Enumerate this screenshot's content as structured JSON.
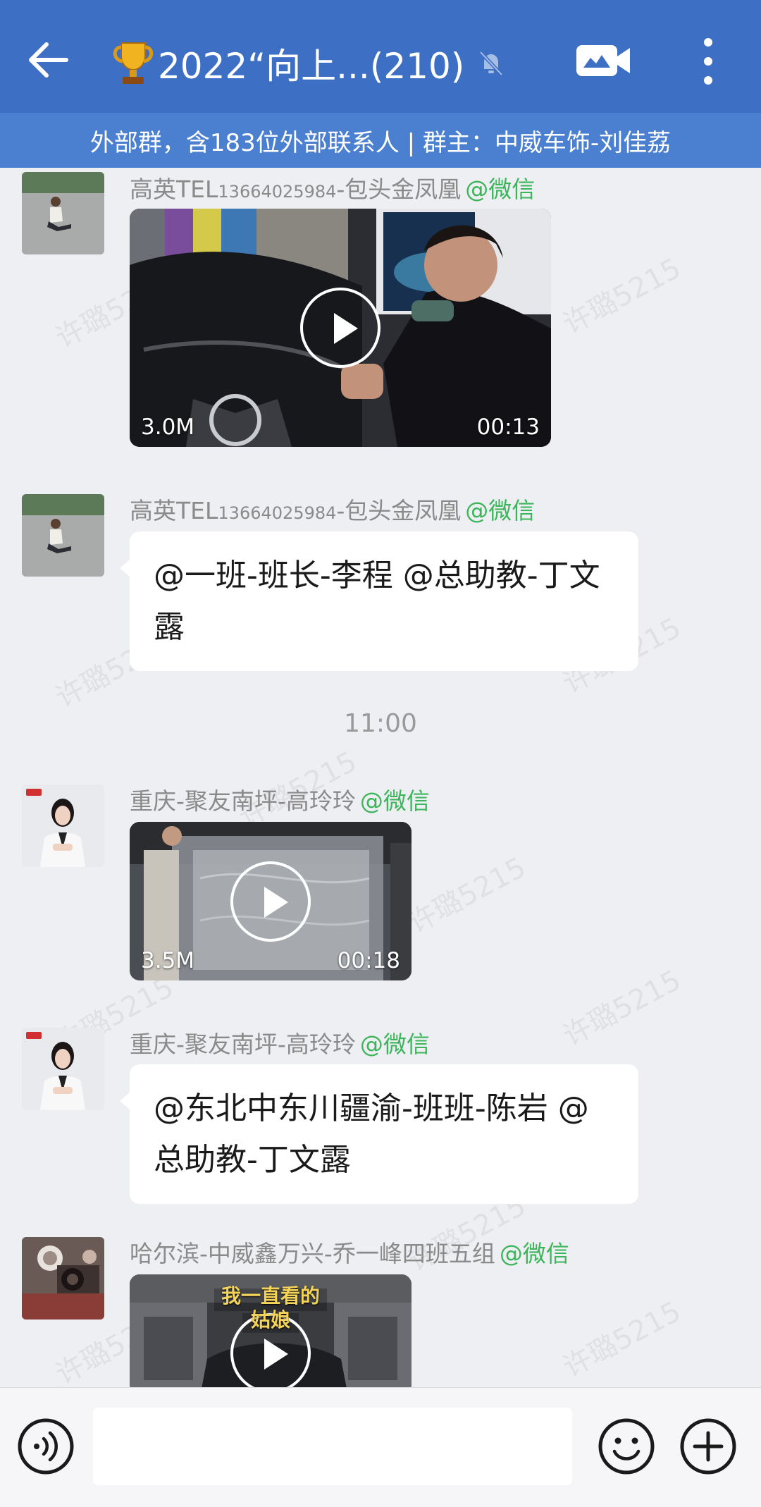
{
  "header": {
    "title": "2022“向上...(210)",
    "subtitle": "外部群，含183位外部联系人 | 群主：中威车饰-刘佳荔"
  },
  "colors": {
    "header_bg": "#3d6fc4",
    "subheader_bg": "#4b7fd0",
    "chat_bg": "#eeeff3",
    "wechat_tag": "#3cb55a"
  },
  "watermark": "许璐5215",
  "messages": [
    {
      "sender_name": "高英",
      "sender_tel_prefix": "TEL",
      "sender_tel": "13664025984",
      "sender_suffix": "-包头金凤凰",
      "source": "@微信",
      "type": "video",
      "size": "3.0M",
      "duration": "00:13"
    },
    {
      "sender_name": "高英",
      "sender_tel_prefix": "TEL",
      "sender_tel": "13664025984",
      "sender_suffix": "-包头金凤凰",
      "source": "@微信",
      "type": "text",
      "text": "@一班-班长-李程 @总助教-丁文露"
    },
    {
      "type": "time",
      "text": "11:00"
    },
    {
      "sender": "重庆-聚友南坪-高玲玲",
      "source": "@微信",
      "type": "video",
      "size": "3.5M",
      "duration": "00:18"
    },
    {
      "sender": "重庆-聚友南坪-高玲玲",
      "source": "@微信",
      "type": "text",
      "text": "@东北中东川疆渝-班班-陈岩 @总助教-丁文露"
    },
    {
      "sender": "哈尔滨-中威鑫万兴-乔一峰四班五组",
      "source": "@微信",
      "type": "video",
      "overlay_text": "我一直看的 姑娘"
    }
  ],
  "icons": {
    "back": "arrow-left-icon",
    "trophy": "trophy-icon",
    "mute": "bell-off-icon",
    "video_call": "video-camera-icon",
    "more": "more-vertical-icon",
    "voice": "voice-icon",
    "emoji": "emoji-icon",
    "plus": "plus-icon"
  }
}
